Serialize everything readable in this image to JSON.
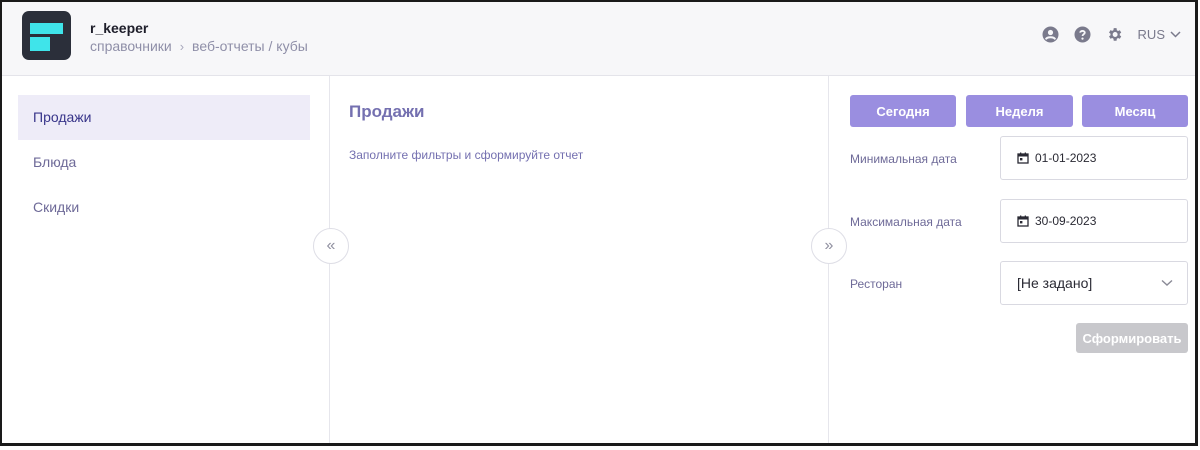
{
  "header": {
    "app_name": "r_keeper",
    "breadcrumb": [
      "справочники",
      "веб-отчеты / кубы"
    ],
    "breadcrumb_separator": "›",
    "icons": [
      "user-icon",
      "help-icon",
      "gear-icon"
    ],
    "language": "RUS"
  },
  "nav": {
    "items": [
      {
        "label": "Продажи",
        "active": true
      },
      {
        "label": "Блюда",
        "active": false
      },
      {
        "label": "Скидки",
        "active": false
      }
    ]
  },
  "main": {
    "title": "Продажи",
    "hint": "Заполните фильтры и сформируйте отчет",
    "collapse_left": "«",
    "collapse_right": "»"
  },
  "filters": {
    "period_buttons": [
      "Сегодня",
      "Неделя",
      "Месяц"
    ],
    "min_date_label": "Минимальная дата",
    "min_date_value": "01-01-2023",
    "max_date_label": "Максимальная дата",
    "max_date_value": "30-09-2023",
    "restaurant_label": "Ресторан",
    "restaurant_value": "[Не задано]",
    "submit_label": "Сформировать"
  },
  "colors": {
    "accent": "#9a8ee0",
    "logo_bg": "#2b2f3a",
    "logo_fg": "#3fe4ea",
    "nav_active_bg": "#eeecf8",
    "disabled": "#c8c8cc"
  }
}
